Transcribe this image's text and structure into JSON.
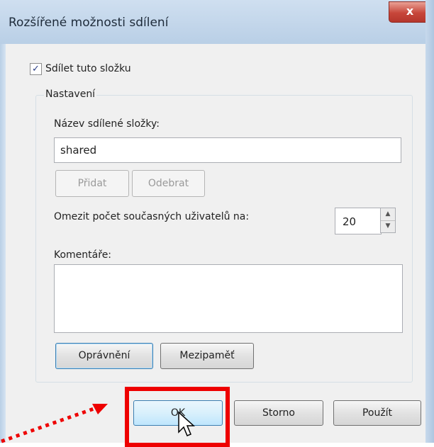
{
  "window": {
    "title": "Rozšířené možnosti sdílení",
    "close_glyph": "x"
  },
  "share_checkbox": {
    "label": "Sdílet tuto složku",
    "checked": true,
    "check_glyph": "✓"
  },
  "settings": {
    "legend": "Nastavení",
    "share_name_label": "Název sdílené složky:",
    "share_name_value": "shared",
    "add_button": "Přidat",
    "remove_button": "Odebrat",
    "limit_label": "Omezit počet současných uživatelů na:",
    "limit_value": "20",
    "comments_label": "Komentáře:",
    "comments_value": "",
    "permissions_button": "Oprávnění",
    "cache_button": "Mezipaměť"
  },
  "footer": {
    "ok_button": "OK",
    "cancel_button": "Storno",
    "apply_button": "Použít"
  },
  "annotation": {
    "highlight_color": "#ee0000",
    "arrow_style": "dotted",
    "cursor_icon": "pointer-arrow-icon"
  }
}
